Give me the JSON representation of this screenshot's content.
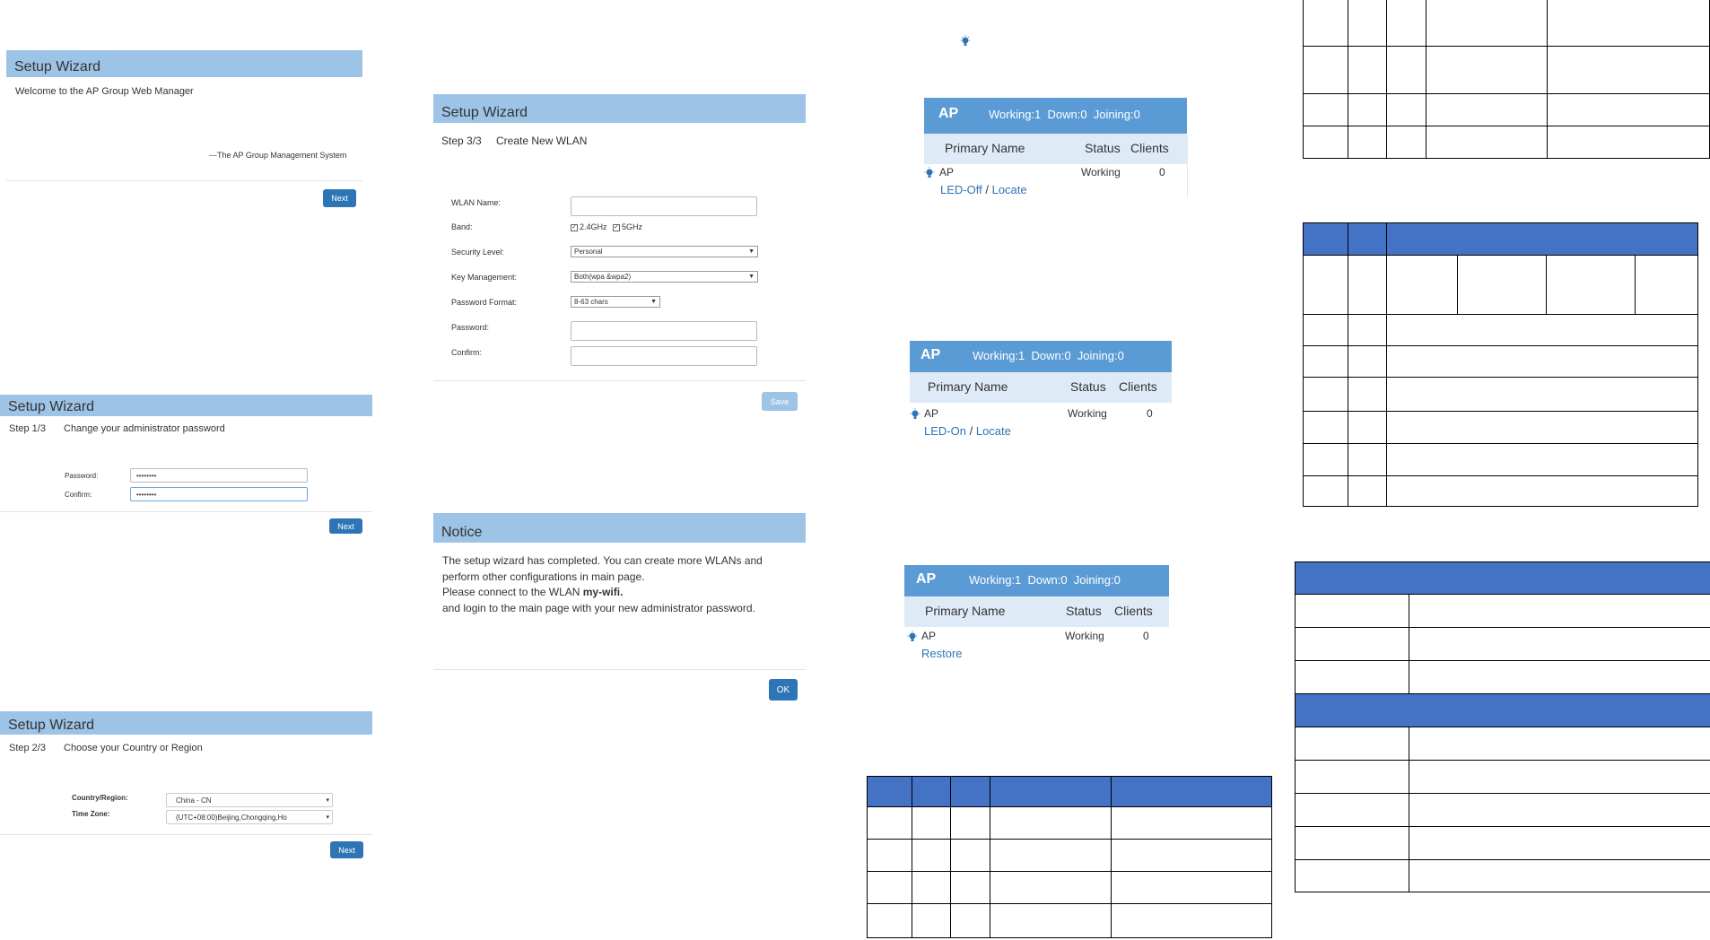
{
  "wizard_welcome": {
    "title": "Setup Wizard",
    "welcome": "Welcome to the AP Group Web Manager",
    "signature": "---The AP Group Management System",
    "next_label": "Next"
  },
  "wizard_step1": {
    "title": "Setup Wizard",
    "step": "Step 1/3",
    "step_desc": "Change your administrator password",
    "password_label": "Password:",
    "password_value": "••••••••",
    "confirm_label": "Confirm:",
    "confirm_value": "••••••••",
    "next_label": "Next"
  },
  "wizard_step2": {
    "title": "Setup Wizard",
    "step": "Step 2/3",
    "step_desc": "Choose your Country or Region",
    "country_label": "Country/Region:",
    "country_value": "China - CN",
    "timezone_label": "Time Zone:",
    "timezone_value": "(UTC+08:00)Beijing,Chongqing,Ho",
    "next_label": "Next"
  },
  "wizard_step3": {
    "title": "Setup Wizard",
    "step": "Step 3/3",
    "step_desc": "Create New WLAN",
    "wlan_name_label": "WLAN Name:",
    "band_label": "Band:",
    "band_24": "2.4GHz",
    "band_5": "5GHz",
    "security_label": "Security Level:",
    "security_value": "Personal",
    "key_mgmt_label": "Key Management:",
    "key_mgmt_value": "Both(wpa &wpa2)",
    "pw_format_label": "Password Format:",
    "pw_format_value": "8-63 chars",
    "password_label": "Password:",
    "confirm_label": "Confirm:",
    "save_label": "Save"
  },
  "notice": {
    "title": "Notice",
    "line1": "The setup wizard has completed. You can create more WLANs and",
    "line2": "perform other configurations in main page.",
    "line3_prefix": "Please connect to the WLAN ",
    "line3_wlan": "my-wifi.",
    "line4": "and login to the main page with your new administrator password.",
    "ok_label": "OK"
  },
  "ap_panels": [
    {
      "title": "AP",
      "stats": "Working:1  Down:0  Joining:0",
      "col_name": "Primary Name",
      "col_status": "Status",
      "col_clients": "Clients",
      "row_name": "AP",
      "row_status": "Working",
      "row_clients": "0",
      "action1": "LED-Off",
      "sep": "/",
      "action2": "Locate"
    },
    {
      "title": "AP",
      "stats": "Working:1  Down:0  Joining:0",
      "col_name": "Primary Name",
      "col_status": "Status",
      "col_clients": "Clients",
      "row_name": "AP",
      "row_status": "Working",
      "row_clients": "0",
      "action1": "LED-On",
      "sep": "/",
      "action2": "Locate"
    },
    {
      "title": "AP",
      "stats": "Working:1  Down:0  Joining:0",
      "col_name": "Primary Name",
      "col_status": "Status",
      "col_clients": "Clients",
      "row_name": "AP",
      "row_status": "Working",
      "row_clients": "0",
      "action1": "Restore"
    }
  ],
  "colors": {
    "wizard_header": "#9dc3e6",
    "button": "#2e75b6",
    "ap_header": "#5b9bd5",
    "ap_subheader": "#deebf7",
    "table_header": "#4472c4",
    "link": "#2e75b6"
  },
  "icons": [
    "led-bulb-icon"
  ]
}
